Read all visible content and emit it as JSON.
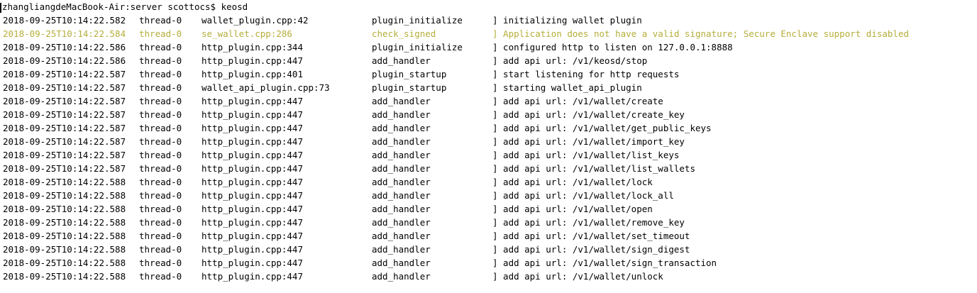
{
  "prompt": {
    "host": "zhangliangdeMacBook-Air:server",
    "user_prompt": "scottocs$",
    "command": "keosd"
  },
  "colors": {
    "background": "#ffffff",
    "text": "#000000",
    "warning": "#b5ae3a"
  },
  "log_lines": [
    {
      "time": "2018-09-25T10:14:22.582",
      "thread": "thread-0",
      "file": "wallet_plugin.cpp:42",
      "func": "plugin_initialize",
      "msg": "] initializing wallet plugin",
      "level": "info"
    },
    {
      "time": "2018-09-25T10:14:22.584",
      "thread": "thread-0",
      "file": "se_wallet.cpp:286",
      "func": "check_signed",
      "msg": "] Application does not have a valid signature; Secure Enclave support disabled",
      "level": "warn"
    },
    {
      "time": "2018-09-25T10:14:22.586",
      "thread": "thread-0",
      "file": "http_plugin.cpp:344",
      "func": "plugin_initialize",
      "msg": "] configured http to listen on 127.0.0.1:8888",
      "level": "info"
    },
    {
      "time": "2018-09-25T10:14:22.586",
      "thread": "thread-0",
      "file": "http_plugin.cpp:447",
      "func": "add_handler",
      "msg": "] add api url: /v1/keosd/stop",
      "level": "info"
    },
    {
      "time": "2018-09-25T10:14:22.587",
      "thread": "thread-0",
      "file": "http_plugin.cpp:401",
      "func": "plugin_startup",
      "msg": "] start listening for http requests",
      "level": "info"
    },
    {
      "time": "2018-09-25T10:14:22.587",
      "thread": "thread-0",
      "file": "wallet_api_plugin.cpp:73",
      "func": "plugin_startup",
      "msg": "] starting wallet_api_plugin",
      "level": "info"
    },
    {
      "time": "2018-09-25T10:14:22.587",
      "thread": "thread-0",
      "file": "http_plugin.cpp:447",
      "func": "add_handler",
      "msg": "] add api url: /v1/wallet/create",
      "level": "info"
    },
    {
      "time": "2018-09-25T10:14:22.587",
      "thread": "thread-0",
      "file": "http_plugin.cpp:447",
      "func": "add_handler",
      "msg": "] add api url: /v1/wallet/create_key",
      "level": "info"
    },
    {
      "time": "2018-09-25T10:14:22.587",
      "thread": "thread-0",
      "file": "http_plugin.cpp:447",
      "func": "add_handler",
      "msg": "] add api url: /v1/wallet/get_public_keys",
      "level": "info"
    },
    {
      "time": "2018-09-25T10:14:22.587",
      "thread": "thread-0",
      "file": "http_plugin.cpp:447",
      "func": "add_handler",
      "msg": "] add api url: /v1/wallet/import_key",
      "level": "info"
    },
    {
      "time": "2018-09-25T10:14:22.587",
      "thread": "thread-0",
      "file": "http_plugin.cpp:447",
      "func": "add_handler",
      "msg": "] add api url: /v1/wallet/list_keys",
      "level": "info"
    },
    {
      "time": "2018-09-25T10:14:22.587",
      "thread": "thread-0",
      "file": "http_plugin.cpp:447",
      "func": "add_handler",
      "msg": "] add api url: /v1/wallet/list_wallets",
      "level": "info"
    },
    {
      "time": "2018-09-25T10:14:22.588",
      "thread": "thread-0",
      "file": "http_plugin.cpp:447",
      "func": "add_handler",
      "msg": "] add api url: /v1/wallet/lock",
      "level": "info"
    },
    {
      "time": "2018-09-25T10:14:22.588",
      "thread": "thread-0",
      "file": "http_plugin.cpp:447",
      "func": "add_handler",
      "msg": "] add api url: /v1/wallet/lock_all",
      "level": "info"
    },
    {
      "time": "2018-09-25T10:14:22.588",
      "thread": "thread-0",
      "file": "http_plugin.cpp:447",
      "func": "add_handler",
      "msg": "] add api url: /v1/wallet/open",
      "level": "info"
    },
    {
      "time": "2018-09-25T10:14:22.588",
      "thread": "thread-0",
      "file": "http_plugin.cpp:447",
      "func": "add_handler",
      "msg": "] add api url: /v1/wallet/remove_key",
      "level": "info"
    },
    {
      "time": "2018-09-25T10:14:22.588",
      "thread": "thread-0",
      "file": "http_plugin.cpp:447",
      "func": "add_handler",
      "msg": "] add api url: /v1/wallet/set_timeout",
      "level": "info"
    },
    {
      "time": "2018-09-25T10:14:22.588",
      "thread": "thread-0",
      "file": "http_plugin.cpp:447",
      "func": "add_handler",
      "msg": "] add api url: /v1/wallet/sign_digest",
      "level": "info"
    },
    {
      "time": "2018-09-25T10:14:22.588",
      "thread": "thread-0",
      "file": "http_plugin.cpp:447",
      "func": "add_handler",
      "msg": "] add api url: /v1/wallet/sign_transaction",
      "level": "info"
    },
    {
      "time": "2018-09-25T10:14:22.588",
      "thread": "thread-0",
      "file": "http_plugin.cpp:447",
      "func": "add_handler",
      "msg": "] add api url: /v1/wallet/unlock",
      "level": "info"
    }
  ]
}
